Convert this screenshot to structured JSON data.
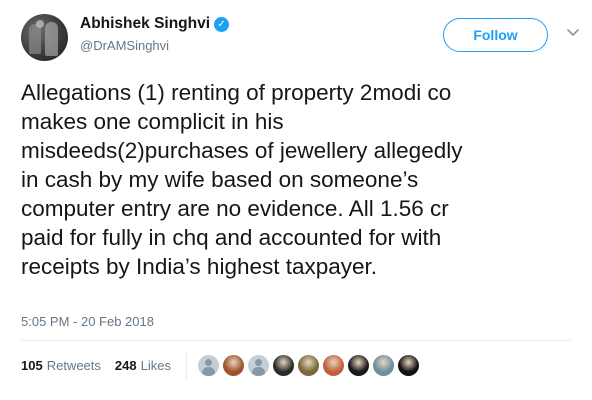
{
  "author": {
    "name": "Abhishek Singhvi",
    "handle": "@DrAMSinghvi",
    "verified_glyph": "✓"
  },
  "follow_label": "Follow",
  "tweet": {
    "text": "Allegations (1) renting of property 2modi co\nmakes one complicit in his\nmisdeeds(2)purchases of jewellery allegedly\nin cash by my wife based on someone’s\ncomputer entry are no evidence. All 1.56 cr\npaid for fully in chq and accounted for with\nreceipts by India’s highest taxpayer.",
    "timestamp": "5:05 PM - 20 Feb 2018"
  },
  "stats": {
    "retweets_count": "105",
    "retweets_label": "Retweets",
    "likes_count": "248",
    "likes_label": "Likes"
  },
  "likers": [
    {
      "style": "default"
    },
    {
      "style": "photo",
      "color": "#a0522d"
    },
    {
      "style": "default"
    },
    {
      "style": "photo",
      "color": "#2b2b2b"
    },
    {
      "style": "photo",
      "color": "#7a6a3a"
    },
    {
      "style": "photo",
      "color": "#c0603a"
    },
    {
      "style": "photo",
      "color": "#1a1a1a"
    },
    {
      "style": "photo",
      "color": "#6b8f9c"
    },
    {
      "style": "photo",
      "color": "#111111"
    }
  ],
  "colors": {
    "accent": "#1da1f2",
    "text": "#14171a",
    "muted": "#657786"
  }
}
